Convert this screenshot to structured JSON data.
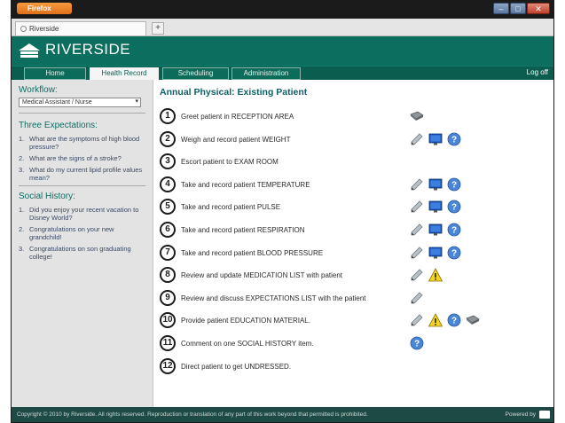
{
  "browser": {
    "menu_button": "Firefox",
    "tab_label": "Riverside",
    "new_tab": "+",
    "controls": [
      "–",
      "□",
      "✕"
    ]
  },
  "app": {
    "brand": "RIVERSIDE",
    "brand_color": "#0c6e5e",
    "nav": [
      "Home",
      "Health Record",
      "Scheduling",
      "Administration"
    ],
    "active_nav": "Health Record",
    "logoff": "Log off"
  },
  "sidebar": {
    "workflow_label": "Workflow:",
    "workflow_value": "Medical Assistant / Nurse",
    "expectations_heading": "Three Expectations:",
    "expectations": [
      {
        "num": "1.",
        "text": "What are the symptoms of high blood pressure?"
      },
      {
        "num": "2.",
        "text": "What are the signs of a stroke?"
      },
      {
        "num": "3.",
        "text": "What do my current lipid profile values mean?"
      }
    ],
    "social_heading": "Social History:",
    "social": [
      {
        "num": "1.",
        "text": "Did you enjoy your recent vacation to Disney World?"
      },
      {
        "num": "2.",
        "text": "Congratulations on your new grandchild!"
      },
      {
        "num": "3.",
        "text": "Congratulations on son graduating college!"
      }
    ]
  },
  "main": {
    "title": "Annual Physical: Existing Patient",
    "steps": [
      {
        "num": "1",
        "text": "Greet patient in RECEPTION AREA",
        "icons": [
          "book-icon"
        ]
      },
      {
        "num": "2",
        "text": "Weigh and record patient WEIGHT",
        "icons": [
          "pencil-icon",
          "monitor-icon",
          "help-icon"
        ]
      },
      {
        "num": "3",
        "text": "Escort patient to EXAM ROOM",
        "icons": []
      },
      {
        "num": "4",
        "text": "Take and record patient TEMPERATURE",
        "icons": [
          "pencil-icon",
          "monitor-icon",
          "help-icon"
        ]
      },
      {
        "num": "5",
        "text": "Take and record patient PULSE",
        "icons": [
          "pencil-icon",
          "monitor-icon",
          "help-icon"
        ]
      },
      {
        "num": "6",
        "text": "Take and record patient RESPIRATION",
        "icons": [
          "pencil-icon",
          "monitor-icon",
          "help-icon"
        ]
      },
      {
        "num": "7",
        "text": "Take and record patient BLOOD PRESSURE",
        "icons": [
          "pencil-icon",
          "monitor-icon",
          "help-icon"
        ]
      },
      {
        "num": "8",
        "text": "Review and update MEDICATION LIST with patient",
        "icons": [
          "pencil-icon",
          "warning-icon"
        ]
      },
      {
        "num": "9",
        "text": "Review and discuss EXPECTATIONS LIST with the patient",
        "icons": [
          "pencil-icon"
        ]
      },
      {
        "num": "10",
        "text": "Provide patient EDUCATION MATERIAL.",
        "icons": [
          "pencil-icon",
          "warning-icon",
          "help-icon",
          "book-icon"
        ]
      },
      {
        "num": "11",
        "text": "Comment on one SOCIAL HISTORY item.",
        "icons": [
          "help-icon"
        ]
      },
      {
        "num": "12",
        "text": "Direct patient to get UNDRESSED.",
        "icons": []
      }
    ]
  },
  "footer": {
    "copyright": "Copyright © 2010 by Riverside. All rights reserved. Reproduction or translation of any part of this work beyond that permitted is prohibited.",
    "powered": "Powered by"
  }
}
